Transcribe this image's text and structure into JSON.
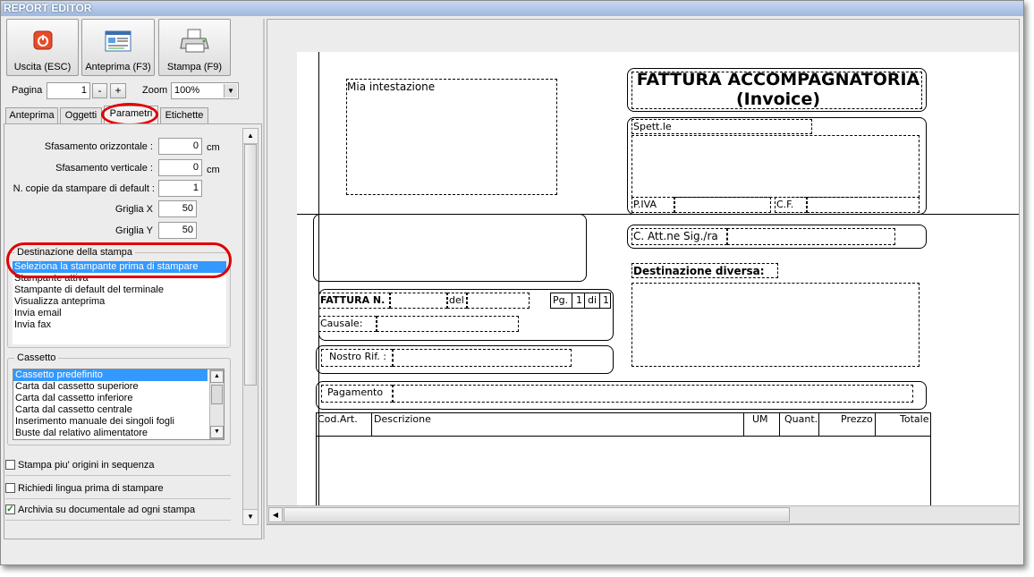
{
  "window": {
    "title": "REPORT EDITOR"
  },
  "toolbar": {
    "exit_label": "Uscita (ESC)",
    "preview_label": "Anteprima (F3)",
    "print_label": "Stampa (F9)"
  },
  "nav": {
    "page_label": "Pagina",
    "page_value": "1",
    "minus": "-",
    "plus": "+",
    "zoom_label": "Zoom",
    "zoom_value": "100%"
  },
  "tabs": [
    "Anteprima",
    "Oggetti",
    "Parametri",
    "Etichette"
  ],
  "params": {
    "offset_h_label": "Sfasamento orizzontale :",
    "offset_h_value": "0",
    "offset_h_unit": "cm",
    "offset_v_label": "Sfasamento verticale :",
    "offset_v_value": "0",
    "offset_v_unit": "cm",
    "copies_label": "N. copie da stampare di default :",
    "copies_value": "1",
    "grid_x_label": "Griglia X",
    "grid_x_value": "50",
    "grid_y_label": "Griglia Y",
    "grid_y_value": "50"
  },
  "destination": {
    "title": "Destinazione della stampa",
    "items": [
      "Seleziona la stampante prima di stampare",
      "Stampante attiva",
      "Stampante di default del terminale",
      "Visualizza anteprima",
      "Invia email",
      "Invia fax"
    ]
  },
  "tray": {
    "title": "Cassetto",
    "items": [
      "Cassetto predefinito",
      "Carta dal cassetto superiore",
      "Carta dal cassetto inferiore",
      "Carta dal cassetto centrale",
      "Inserimento manuale dei singoli fogli",
      "Buste dal relativo alimentatore"
    ]
  },
  "checkboxes": {
    "multi_origins": {
      "label": "Stampa piu' origini in sequenza",
      "checked": false
    },
    "ask_language": {
      "label": "Richiedi lingua prima di stampare",
      "checked": false
    },
    "archive": {
      "label": "Archivia su documentale ad ogni stampa",
      "checked": true
    }
  },
  "report": {
    "header_placeholder": "Mia intestazione",
    "title_line1": "FATTURA ACCOMPAGNATORIA",
    "title_line2": "(Invoice)",
    "spett": "Spett.le",
    "piva": "P.IVA",
    "cf": "C.F.",
    "att": "C. Att.ne Sig./ra",
    "dest_diversa": "Destinazione diversa:",
    "fattura_n": "FATTURA N.",
    "del": "del",
    "pg": "Pg.",
    "pg_current": "1",
    "pg_of": "di",
    "pg_total": "1",
    "causale": "Causale:",
    "nostro_rif": "Nostro Rif. :",
    "pagamento": "Pagamento",
    "columns": [
      "Cod.Art.",
      "Descrizione",
      "UM",
      "Quant.",
      "Prezzo",
      "Totale"
    ]
  }
}
